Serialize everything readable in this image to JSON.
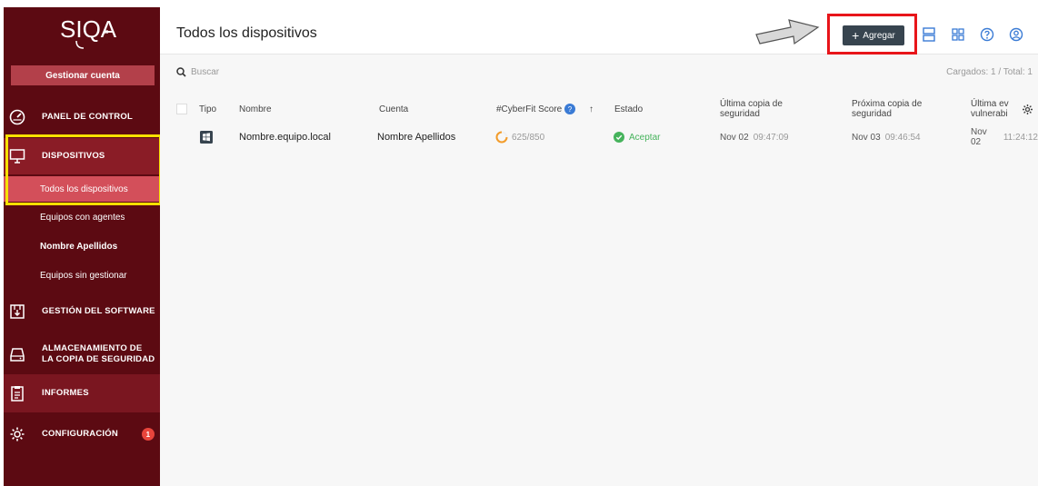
{
  "sidebar": {
    "logo_text": "SIQA",
    "manage_account": "Gestionar cuenta",
    "items": {
      "panel": "PANEL DE CONTROL",
      "devices": "DISPOSITIVOS",
      "all_devices": "Todos los dispositivos",
      "agent_machines": "Equipos con agentes",
      "user_name": "Nombre Apellidos",
      "unmanaged": "Equipos sin gestionar",
      "software_1": "GESTIÓN DEL SOFTWARE",
      "backup_line1": "ALMACENAMIENTO DE",
      "backup_line2": "LA COPIA DE SEGURIDAD",
      "reports": "INFORMES",
      "settings": "CONFIGURACIÓN",
      "settings_badge": "1"
    }
  },
  "header": {
    "title": "Todos los dispositivos",
    "add_label": "Agregar"
  },
  "toolbar": {
    "search_placeholder": "Buscar",
    "loaded": "Cargados: 1 / Total: 1"
  },
  "table": {
    "columns": {
      "type": "Tipo",
      "name": "Nombre",
      "account": "Cuenta",
      "cyberfit": "#CyberFit Score",
      "sort_arrow": "↑",
      "status": "Estado",
      "last_backup_1": "Última copia de",
      "last_backup_2": "seguridad",
      "next_backup_1": "Próxima copia de",
      "next_backup_2": "seguridad",
      "last_vuln_1": "Última ev",
      "last_vuln_2": "vulnerabi"
    },
    "rows": [
      {
        "name": "Nombre.equipo.local",
        "account": "Nombre Apellidos",
        "score": "625/850",
        "status": "Aceptar",
        "last_backup_date": "Nov 02",
        "last_backup_time": "09:47:09",
        "next_backup_date": "Nov 03",
        "next_backup_time": "09:46:54",
        "last_vuln_date": "Nov 02",
        "last_vuln_time": "11:24:12"
      }
    ]
  },
  "colors": {
    "sidebar_bg": "#5c0a12",
    "active_sub": "#d34f5a",
    "highlight_yellow": "#f7e000",
    "highlight_red": "#e8151a",
    "add_button": "#37444f",
    "ok_green": "#46b35c"
  }
}
